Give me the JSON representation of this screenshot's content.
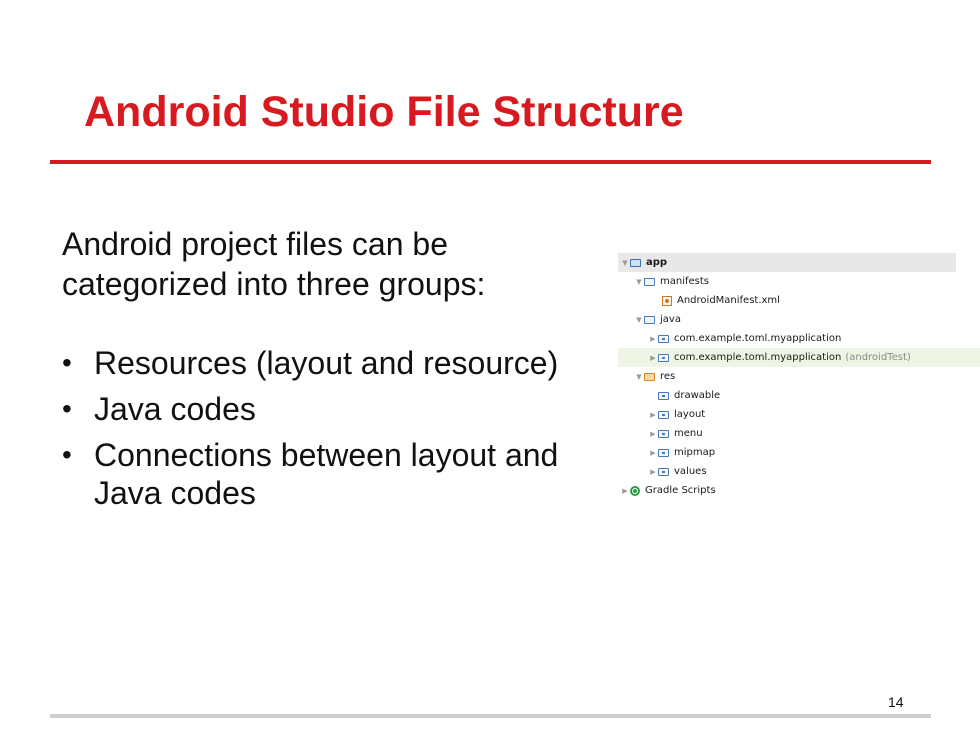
{
  "slide": {
    "title": "Android Studio File Structure",
    "intro": "Android project files can be categorized into three groups:",
    "bullets": [
      "Resources (layout and resource)",
      "Java codes",
      "Connections between layout and Java codes"
    ],
    "bullet_glyph": "•",
    "page_number": "14"
  },
  "tree": {
    "app": "app",
    "manifests": "manifests",
    "android_manifest": "AndroidManifest.xml",
    "java": "java",
    "pkg_main": "com.example.toml.myapplication",
    "pkg_test": "com.example.toml.myapplication",
    "pkg_test_suffix": "(androidTest)",
    "res": "res",
    "drawable": "drawable",
    "layout": "layout",
    "menu": "menu",
    "mipmap": "mipmap",
    "values": "values",
    "gradle_scripts": "Gradle Scripts",
    "expanded_glyph": "▼",
    "collapsed_glyph": "▶"
  },
  "colors": {
    "accent": "#d71920",
    "rule_footer": "#cfcfcf",
    "selection": "#e8e8e8",
    "hover": "#eef5e4"
  }
}
